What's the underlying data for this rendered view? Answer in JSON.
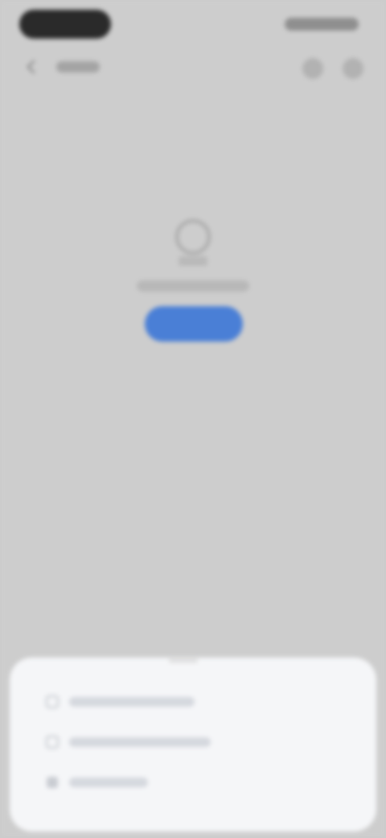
{
  "status_bar": {
    "time": "",
    "indicators": ""
  },
  "header": {
    "title": "",
    "icons": [
      "search-icon",
      "more-icon"
    ]
  },
  "empty_state": {
    "message": "",
    "button_label": "",
    "icon": "empty-folder-icon"
  },
  "bottom_sheet": {
    "items": [
      {
        "icon": "add-icon",
        "label": ""
      },
      {
        "icon": "link-icon",
        "label": ""
      },
      {
        "icon": "settings-icon",
        "label": ""
      }
    ]
  },
  "colors": {
    "background": "#cdcdcd",
    "accent": "#4a7fd6",
    "sheet": "#f5f6f8"
  }
}
